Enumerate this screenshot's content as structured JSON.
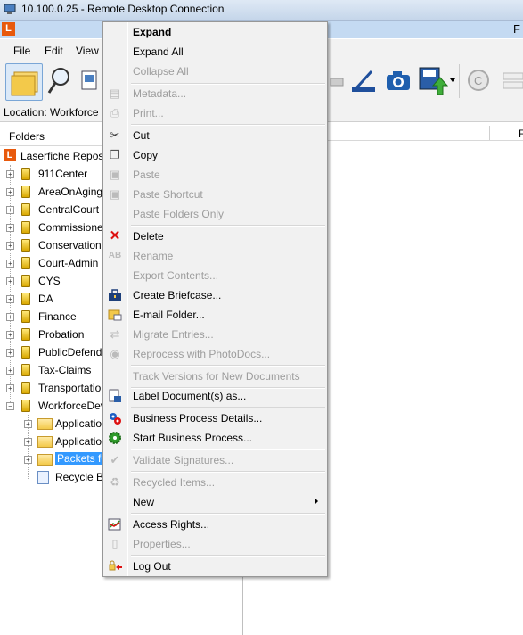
{
  "rdp_title": "10.100.0.25 - Remote Desktop Connection",
  "app": {
    "logo": "L",
    "title_fragment": "F"
  },
  "menubar": {
    "items": [
      "File",
      "Edit",
      "View"
    ]
  },
  "location": {
    "label": "Location:",
    "value": "Workforce"
  },
  "folders_header": "Folders",
  "right_header_fragment": "F",
  "tree": {
    "root": "Laserfiche Reposi",
    "cabinets": [
      "911Center",
      "AreaOnAging",
      "CentralCourt",
      "Commissione",
      "Conservation",
      "Court-Admin",
      "CYS",
      "DA",
      "Finance",
      "Probation",
      "PublicDefend",
      "Tax-Claims",
      "Transportatio",
      "WorkforceDev"
    ],
    "children": [
      "Applicatio",
      "Applicatio",
      "Packets fo",
      "Recycle Bi"
    ]
  },
  "context_menu": {
    "items": [
      {
        "label": "Expand",
        "icon": "none",
        "disabled": false,
        "bold": true
      },
      {
        "label": "Expand All",
        "icon": "none",
        "disabled": false
      },
      {
        "label": "Collapse All",
        "icon": "none",
        "disabled": true
      },
      {
        "label": "Metadata...",
        "icon": "metadata-icon",
        "disabled": true
      },
      {
        "label": "Print...",
        "icon": "printer-icon",
        "disabled": true
      },
      {
        "label": "Cut",
        "icon": "scissors-icon",
        "disabled": false
      },
      {
        "label": "Copy",
        "icon": "copy-icon",
        "disabled": false
      },
      {
        "label": "Paste",
        "icon": "paste-icon",
        "disabled": true
      },
      {
        "label": "Paste Shortcut",
        "icon": "paste-shortcut-icon",
        "disabled": true
      },
      {
        "label": "Paste Folders Only",
        "icon": "none",
        "disabled": true
      },
      {
        "label": "Delete",
        "icon": "delete-x-icon",
        "disabled": false
      },
      {
        "label": "Rename",
        "icon": "rename-icon",
        "disabled": true
      },
      {
        "label": "Export Contents...",
        "icon": "none",
        "disabled": true
      },
      {
        "label": "Create Briefcase...",
        "icon": "briefcase-icon",
        "disabled": false
      },
      {
        "label": "E-mail Folder...",
        "icon": "email-folder-icon",
        "disabled": false
      },
      {
        "label": "Migrate Entries...",
        "icon": "migrate-icon",
        "disabled": true
      },
      {
        "label": "Reprocess with PhotoDocs...",
        "icon": "camera-icon",
        "disabled": true
      },
      {
        "label": "Track Versions for New Documents",
        "icon": "none",
        "disabled": true
      },
      {
        "label": "Label Document(s) as...",
        "icon": "label-doc-icon",
        "disabled": false
      },
      {
        "label": "Business Process Details...",
        "icon": "gears-icon",
        "disabled": false
      },
      {
        "label": "Start Business Process...",
        "icon": "gear-green-icon",
        "disabled": false
      },
      {
        "label": "Validate Signatures...",
        "icon": "signature-icon",
        "disabled": true
      },
      {
        "label": "Recycled Items...",
        "icon": "recycle-icon",
        "disabled": true
      },
      {
        "label": "New",
        "icon": "none",
        "disabled": false,
        "submenu": true
      },
      {
        "label": "Access Rights...",
        "icon": "access-rights-icon",
        "disabled": false
      },
      {
        "label": "Properties...",
        "icon": "properties-icon",
        "disabled": true
      },
      {
        "label": "Log Out",
        "icon": "logout-icon",
        "disabled": false
      }
    ]
  }
}
